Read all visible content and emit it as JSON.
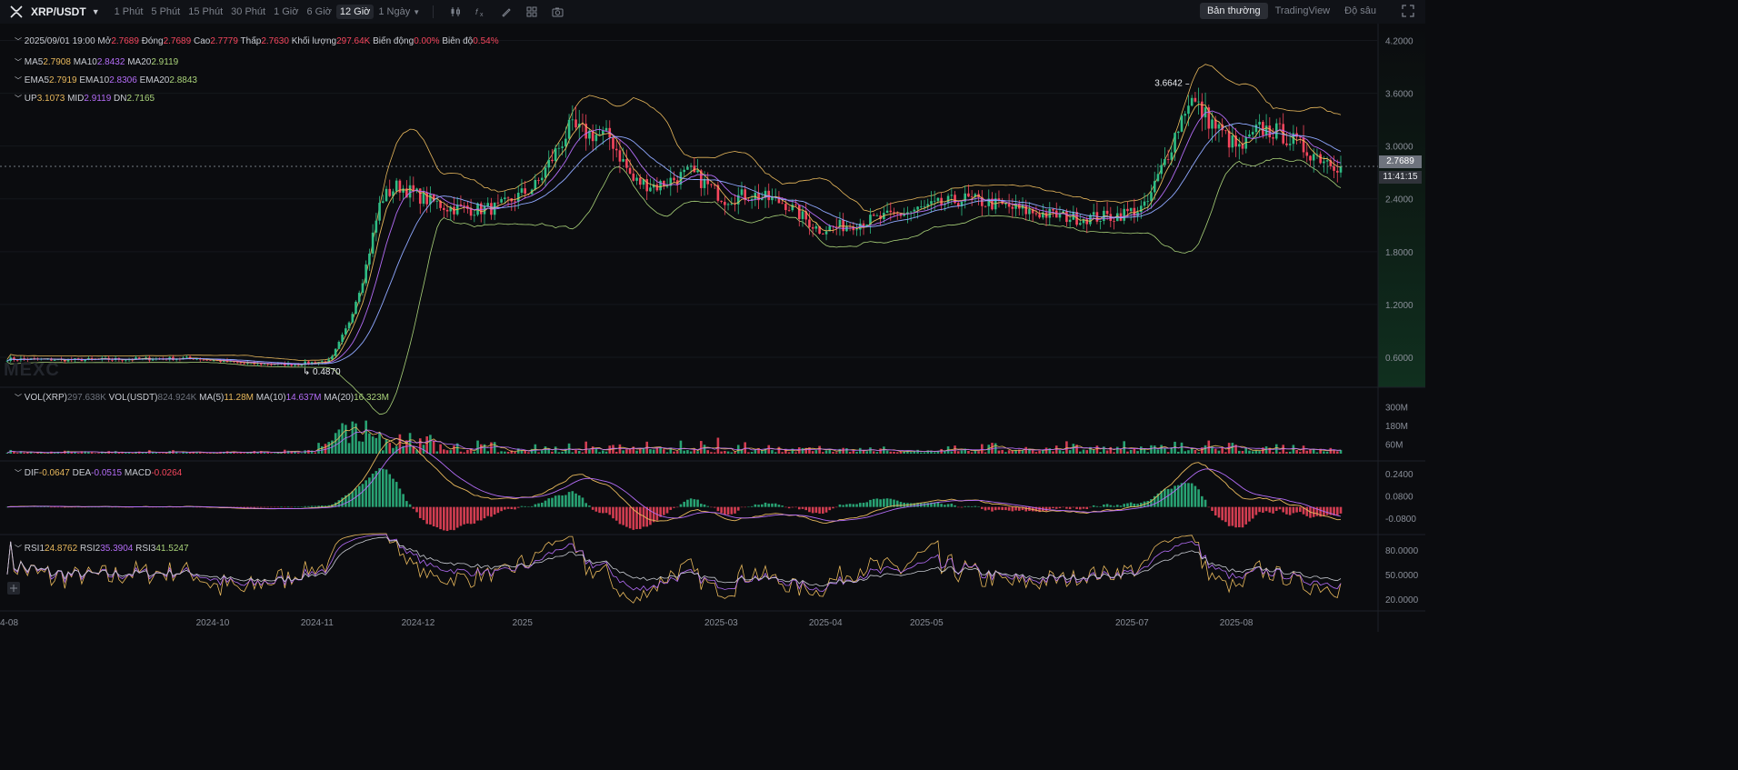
{
  "toolbar": {
    "pair": "XRP/USDT",
    "timeframes": [
      "1 Phút",
      "5 Phút",
      "15 Phút",
      "30 Phút",
      "1 Giờ",
      "6 Giờ",
      "12 Giờ"
    ],
    "active_timeframe": "12 Giờ",
    "more_timeframe": "1 Ngày",
    "tools": [
      "candle-type-icon",
      "indicator-icon",
      "draw-icon",
      "layout-icon",
      "camera-icon"
    ],
    "views": [
      "Bản thường",
      "TradingView",
      "Độ sâu"
    ],
    "active_view": "Bản thường"
  },
  "legend": {
    "date": "2025/09/01 19:00",
    "open_label": "Mở",
    "open": "2.7689",
    "close_label": "Đóng",
    "close": "2.7689",
    "high_label": "Cao",
    "high": "2.7779",
    "low_label": "Thấp",
    "low": "2.7630",
    "volume_label": "Khối lượng",
    "volume": "297.64K",
    "change_label": "Biến động",
    "change": "0.00%",
    "amplitude_label": "Biên độ",
    "amplitude": "0.54%",
    "ma_labels": [
      "MA5",
      "MA10",
      "MA20"
    ],
    "ma_values": [
      "2.7908",
      "2.8432",
      "2.9119"
    ],
    "ema_labels": [
      "EMA5",
      "EMA10",
      "EMA20"
    ],
    "ema_values": [
      "2.7919",
      "2.8306",
      "2.8843"
    ],
    "boll_labels": [
      "UP",
      "MID",
      "DN"
    ],
    "boll_values": [
      "3.1073",
      "2.9119",
      "2.7165"
    ]
  },
  "volume_legend": {
    "vol_xrp_label": "VOL(XRP)",
    "vol_xrp": "297.638K",
    "vol_usdt_label": "VOL(USDT)",
    "vol_usdt": "824.924K",
    "ma5_label": "MA(5)",
    "ma5": "11.28M",
    "ma10_label": "MA(10)",
    "ma10": "14.637M",
    "ma20_label": "MA(20)",
    "ma20": "16.323M"
  },
  "macd_legend": {
    "dif_label": "DIF",
    "dif": "-0.0647",
    "dea_label": "DEA",
    "dea": "-0.0515",
    "macd_label": "MACD",
    "macd": "-0.0264"
  },
  "rsi_legend": {
    "rsi1_label": "RSI1",
    "rsi1": "24.8762",
    "rsi2_label": "RSI2",
    "rsi2": "35.3904",
    "rsi3_label": "RSI3",
    "rsi3": "41.5247"
  },
  "watermark": "MEXC",
  "price_badge": "2.7689",
  "countdown_badge": "11:41:15",
  "colors": {
    "up": "#2ebd85",
    "down": "#f6465d",
    "ma5": "#e8b85c",
    "ma10": "#b36cf6",
    "ma20": "#a9d279",
    "background": "#0b0c0f"
  },
  "chart_data": [
    {
      "type": "candlestick",
      "title": "XRP/USDT",
      "interval": "12 Giờ",
      "x_ticks": [
        "4-08",
        "2024-10",
        "2024-11",
        "2024-12",
        "2025",
        "2025-03",
        "2025-04",
        "2025-05",
        "2025-07",
        "2025-08"
      ],
      "y_ticks": [
        "4.2000",
        "3.6000",
        "3.0000",
        "2.4000",
        "1.8000",
        "1.2000",
        "0.6000"
      ],
      "ylim": [
        0.3,
        4.35
      ],
      "annotations": [
        {
          "text": "3.6642",
          "kind": "max",
          "x": "2025-07-18",
          "y": 3.6642
        },
        {
          "text": "0.4870",
          "kind": "min",
          "x": "2024-10-25",
          "y": 0.487
        }
      ],
      "last_price": 2.7689,
      "series": [
        {
          "name": "MA5",
          "value": 2.7908
        },
        {
          "name": "MA10",
          "value": 2.8432
        },
        {
          "name": "MA20",
          "value": 2.9119
        },
        {
          "name": "UP",
          "value": 3.1073
        },
        {
          "name": "DN",
          "value": 2.7165
        }
      ],
      "close_path": {
        "x": [
          "2024-08-01",
          "2024-08-20",
          "2024-09-10",
          "2024-09-25",
          "2024-10-10",
          "2024-10-25",
          "2024-11-05",
          "2024-11-10",
          "2024-11-15",
          "2024-11-20",
          "2024-11-25",
          "2024-12-03",
          "2024-12-10",
          "2024-12-18",
          "2024-12-25",
          "2025-01-05",
          "2025-01-15",
          "2025-01-20",
          "2025-01-27",
          "2025-02-03",
          "2025-02-10",
          "2025-02-20",
          "2025-03-02",
          "2025-03-10",
          "2025-03-20",
          "2025-03-30",
          "2025-04-07",
          "2025-04-20",
          "2025-05-01",
          "2025-05-12",
          "2025-05-20",
          "2025-06-01",
          "2025-06-15",
          "2025-06-25",
          "2025-07-05",
          "2025-07-12",
          "2025-07-18",
          "2025-07-25",
          "2025-08-02",
          "2025-08-08",
          "2025-08-14",
          "2025-08-22",
          "2025-09-01"
        ],
        "y": [
          0.58,
          0.57,
          0.58,
          0.59,
          0.53,
          0.52,
          0.56,
          0.95,
          1.55,
          2.4,
          2.55,
          2.4,
          2.3,
          2.28,
          2.3,
          2.55,
          3.2,
          3.15,
          3.1,
          2.6,
          2.55,
          2.7,
          2.4,
          2.45,
          2.35,
          2.05,
          2.1,
          2.2,
          2.3,
          2.4,
          2.35,
          2.25,
          2.18,
          2.2,
          2.3,
          2.95,
          3.55,
          3.25,
          2.95,
          3.2,
          3.15,
          2.95,
          2.77
        ]
      }
    },
    {
      "type": "bar",
      "title": "VOL(XRP)",
      "y_ticks": [
        "300M",
        "180M",
        "60M"
      ],
      "ylim": [
        0,
        400
      ],
      "unit": "M",
      "ma": {
        "MA(5)": "11.28M",
        "MA(10)": "14.637M",
        "MA(20)": "16.323M"
      }
    },
    {
      "type": "bar",
      "title": "MACD",
      "y_ticks": [
        "0.2400",
        "0.0800",
        "-0.0800"
      ],
      "ylim": [
        -0.16,
        0.3
      ],
      "values": {
        "DIF": -0.0647,
        "DEA": -0.0515,
        "MACD": -0.0264
      }
    },
    {
      "type": "line",
      "title": "RSI",
      "y_ticks": [
        "80.0000",
        "50.0000",
        "20.0000"
      ],
      "ylim": [
        10,
        92
      ],
      "values": {
        "RSI1": 24.8762,
        "RSI2": 35.3904,
        "RSI3": 41.5247
      }
    }
  ]
}
